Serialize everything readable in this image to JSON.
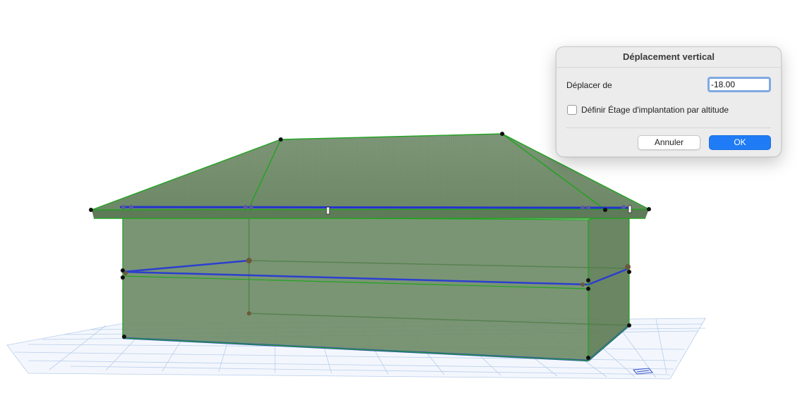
{
  "dialog": {
    "title": "Déplacement vertical",
    "move_label": "Déplacer de",
    "move_value": "-18.00",
    "altitude_label": "Définir Étage d'implantation par altitude",
    "altitude_checked": false,
    "cancel_label": "Annuler",
    "ok_label": "OK"
  },
  "colors": {
    "accent": "#1f7cf6",
    "selection_edge": "#2a9a2a",
    "selection_highlight": "#1a24d6",
    "model_fill": "#6f8c68",
    "grid": "#a9c0e6"
  },
  "viewport": {
    "object": "3D building model (selected)",
    "icons": [
      "pivot-grip-icon",
      "nav-cube-icon"
    ]
  }
}
